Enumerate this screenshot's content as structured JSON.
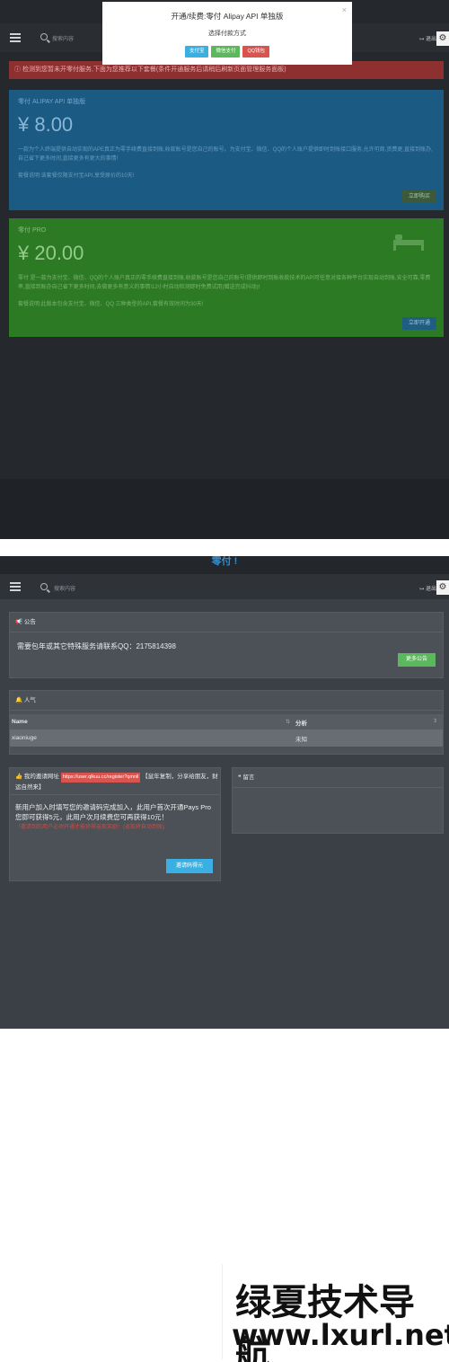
{
  "shot1": {
    "header": {
      "search_placeholder": "搜索内容",
      "logout_label": "退出"
    },
    "modal": {
      "title": "开通/续费:零付 Alipay API 单独版",
      "subtitle": "选择付款方式",
      "buttons": [
        {
          "label": "支付宝",
          "color": "#3ab0e2"
        },
        {
          "label": "微信支付",
          "color": "#5cb85c"
        },
        {
          "label": "QQ钱包",
          "color": "#d9534f"
        }
      ]
    },
    "alert": {
      "text": "检测到您暂未开零付服务,下面为您推荐以下套餐(条件开通服务后请稍后刷新页面管理服务面板)"
    },
    "cards": [
      {
        "label": "零付 ALIPAY API 单独版",
        "price": "¥ 8.00",
        "desc": "一款为个人终端提供自动实现的APE真正为零手续费直接到账,收款账号是您自己的账号。为支付宝、微信、QQ的个人账户提供即时到账接口服务,允许可商,资费更,直接到账办,自己省下更多时间,直接更多有更大的事情!",
        "note": "套餐说明:该套餐仅限支付宝API,享受原价的10天!",
        "button": "立即购买"
      },
      {
        "label": "零付 PRO",
        "price": "¥ 20.00",
        "desc": "零付 是一款为支付宝、微信、QQ的个人账户真正的零手续费直接到账,收款账号是您自己的账号!提供即时到账收款技术的API可任意对接各种平台实现自动到账,安全可靠,零费率,直接到账办自己省下更多时间,去做更多有意义的事情!12小时自动检测即时免费试用(赠送完成抖动)!",
        "note": "套餐说明:此版本包含支付宝、微信、QQ 三种类型的API,套餐有效时间为30天!",
        "button": "立即开通"
      }
    ]
  },
  "shot2": {
    "brand_title": "零付 !",
    "header": {
      "search_placeholder": "搜索内容",
      "logout_label": "退出"
    },
    "notice": {
      "title": "公告",
      "text": "需要包年或其它特殊服务请联系QQ：2175814398",
      "more_button": "更多公告"
    },
    "popular": {
      "title": "人气",
      "columns": [
        "Name",
        "分析"
      ],
      "rows": [
        {
          "name": "xiaoniuge",
          "analysis": "未知"
        }
      ]
    },
    "invite": {
      "title_prefix": "我的邀请网址",
      "url": "https://user.qlkuu.cc/register?qmnll",
      "title_suffix": "【鼠年复制，分享给朋友，财运自然来】",
      "body": "新用户加入时填写您的邀请码完成加入，此用户首次开通Pays Pro您即可获得5元，此用户次月续费您可再获得10元！",
      "red_note": "（邀请到的用户必须开通才能获得返现奖励）(返现将自动到账)",
      "button": "邀请码得元"
    },
    "comments": {
      "title": "留言"
    }
  },
  "watermark": {
    "line1": "绿夏技术导航",
    "line2": "www.lxurl.net"
  }
}
